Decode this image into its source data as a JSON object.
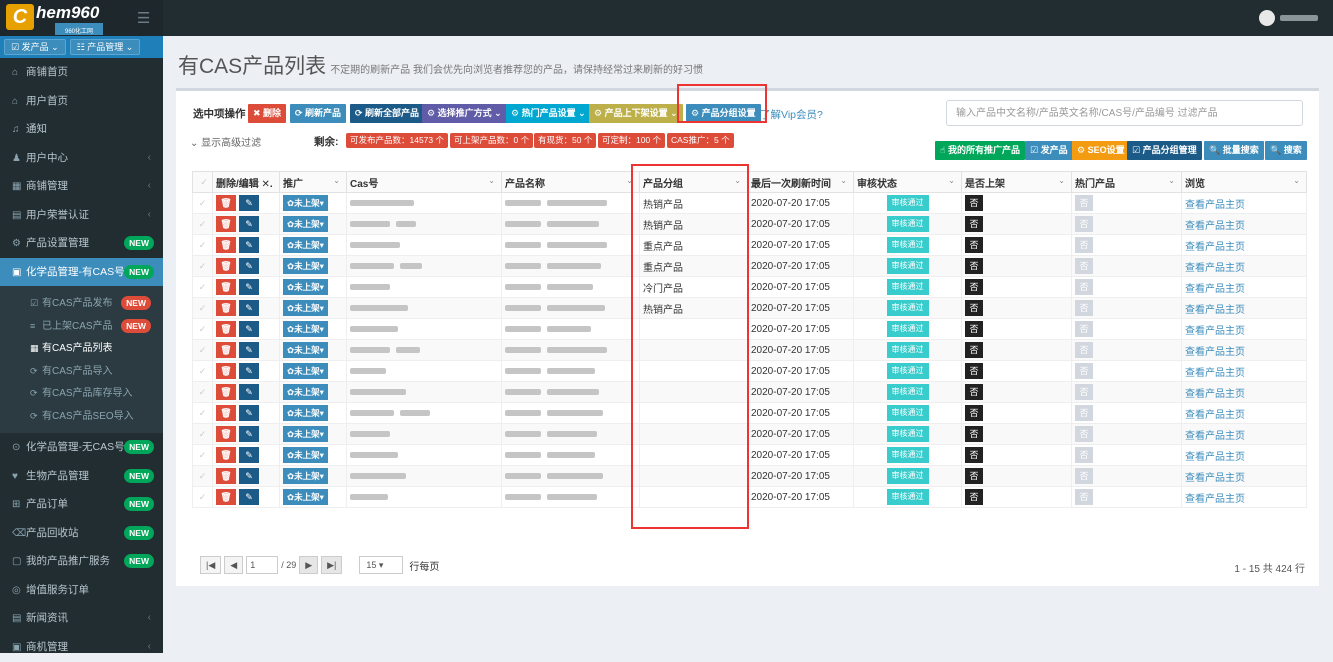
{
  "header": {
    "logo_mark": "C",
    "logo_text": "hem960",
    "logo_sub": "960化工网",
    "menu_icon": "hamburger-icon",
    "user_icon": "avatar-icon"
  },
  "sidebar": {
    "btn_publish": "☑ 发产品 ⌄",
    "btn_manage": "☷ 产品管理 ⌄",
    "items": [
      {
        "icon": "⌂",
        "label": "商铺首页",
        "arrow": "",
        "badge": ""
      },
      {
        "icon": "⌂",
        "label": "用户首页",
        "arrow": "",
        "badge": ""
      },
      {
        "icon": "♫",
        "label": "通知",
        "arrow": "",
        "badge": ""
      },
      {
        "icon": "♟",
        "label": "用户中心",
        "arrow": "‹",
        "badge": ""
      },
      {
        "icon": "▦",
        "label": "商铺管理",
        "arrow": "‹",
        "badge": ""
      },
      {
        "icon": "▤",
        "label": "用户荣誉认证",
        "arrow": "‹",
        "badge": ""
      },
      {
        "icon": "⚙",
        "label": "产品设置管理",
        "arrow": "",
        "badge": "NEW"
      },
      {
        "icon": "▣",
        "label": "化学品管理-有CAS号",
        "arrow": "",
        "badge": "NEW"
      }
    ],
    "sub_items": [
      {
        "icon": "☑",
        "label": "有CAS产品发布",
        "badge": "NEW"
      },
      {
        "icon": "≡",
        "label": "已上架CAS产品",
        "badge": "NEW"
      },
      {
        "icon": "▦",
        "label": "有CAS产品列表",
        "badge": ""
      },
      {
        "icon": "⟳",
        "label": "有CAS产品导入",
        "badge": ""
      },
      {
        "icon": "⟳",
        "label": "有CAS产品库存导入",
        "badge": ""
      },
      {
        "icon": "⟳",
        "label": "有CAS产品SEO导入",
        "badge": ""
      }
    ],
    "items2": [
      {
        "icon": "⊙",
        "label": "化学品管理-无CAS号",
        "arrow": "",
        "badge": "NEW"
      },
      {
        "icon": "♥",
        "label": "生物产品管理",
        "arrow": "",
        "badge": "NEW"
      },
      {
        "icon": "⊞",
        "label": "产品订单",
        "arrow": "",
        "badge": "NEW"
      },
      {
        "icon": "⌫",
        "label": "产品回收站",
        "arrow": "",
        "badge": "NEW"
      },
      {
        "icon": "▢",
        "label": "我的产品推广服务",
        "arrow": "",
        "badge": "NEW"
      },
      {
        "icon": "◎",
        "label": "增值服务订单",
        "arrow": "",
        "badge": ""
      },
      {
        "icon": "▤",
        "label": "新闻资讯",
        "arrow": "‹",
        "badge": ""
      },
      {
        "icon": "▣",
        "label": "商机管理",
        "arrow": "‹",
        "badge": ""
      }
    ]
  },
  "page": {
    "title": "有CAS产品列表",
    "subtitle": "不定期的刷新产品 我们会优先向浏览者推荐您的产品，请保持经常过来刷新的好习惯"
  },
  "toolbar": {
    "label": "选中项操作",
    "delete": "✖ 删除",
    "refresh": "⟳ 刷新产品",
    "refresh_all": "⟳ 刷新全部产品",
    "promote": "⚙ 选择推广方式 ⌄",
    "hot": "⚙ 热门产品设置 ⌄",
    "shelf": "⚙ 产品上下架设置 ⌄",
    "group": "⚙ 产品分组设置",
    "vip": "了解Vip会员?",
    "advanced": "⌄ 显示高级过滤",
    "remain_label": "剩余:",
    "filter_placeholder": "输入产品中文名称/产品英文名称/CAS号/产品编号 过滤产品"
  },
  "quota": [
    "可发布产品数：14573 个",
    "可上架产品数：0 个",
    "有现货：50 个",
    "可定制：100 个",
    "CAS推广：5 个"
  ],
  "actions": {
    "my_promo": "☝ 我的所有推广产品",
    "publish": "☑ 发产品",
    "seo": "⚙ SEO设置",
    "group_manage": "☑ 产品分组管理",
    "batch_search": "🔍 批量搜索",
    "search": "🔍 搜索"
  },
  "table": {
    "headers": [
      "删除/编辑 ✕.",
      "推广",
      "Cas号",
      "产品名称",
      "产品分组",
      "最后一次刷新时间",
      "审核状态",
      "是否上架",
      "热门产品",
      "浏览"
    ],
    "del_icon": "🗑",
    "edit_icon": "✎",
    "promo_label": "✿未上架▾",
    "audit_label": "审核通过",
    "no_label": "否",
    "view_label": "查看产品主页",
    "rows": [
      {
        "group": "热销产品",
        "time": "2020-07-20 17:05"
      },
      {
        "group": "热销产品",
        "time": "2020-07-20 17:05"
      },
      {
        "group": "重点产品",
        "time": "2020-07-20 17:05"
      },
      {
        "group": "重点产品",
        "time": "2020-07-20 17:05"
      },
      {
        "group": "冷门产品",
        "time": "2020-07-20 17:05"
      },
      {
        "group": "热销产品",
        "time": "2020-07-20 17:05"
      },
      {
        "group": "",
        "time": "2020-07-20 17:05"
      },
      {
        "group": "",
        "time": "2020-07-20 17:05"
      },
      {
        "group": "",
        "time": "2020-07-20 17:05"
      },
      {
        "group": "",
        "time": "2020-07-20 17:05"
      },
      {
        "group": "",
        "time": "2020-07-20 17:05"
      },
      {
        "group": "",
        "time": "2020-07-20 17:05"
      },
      {
        "group": "",
        "time": "2020-07-20 17:05"
      },
      {
        "group": "",
        "time": "2020-07-20 17:05"
      },
      {
        "group": "",
        "time": "2020-07-20 17:05"
      }
    ]
  },
  "pager": {
    "first": "|◀",
    "prev": "◀",
    "current": "1",
    "total": "/ 29",
    "next": "▶",
    "last": "▶|",
    "page_size": "15",
    "per_page_label": "行每页",
    "info": "1 - 15 共 424 行"
  },
  "colors": {
    "sidebar": "#222d32",
    "active": "#3c8dbc",
    "danger": "#dd4b39",
    "new_badge": "#00a65a",
    "highlight": "#e33333"
  }
}
